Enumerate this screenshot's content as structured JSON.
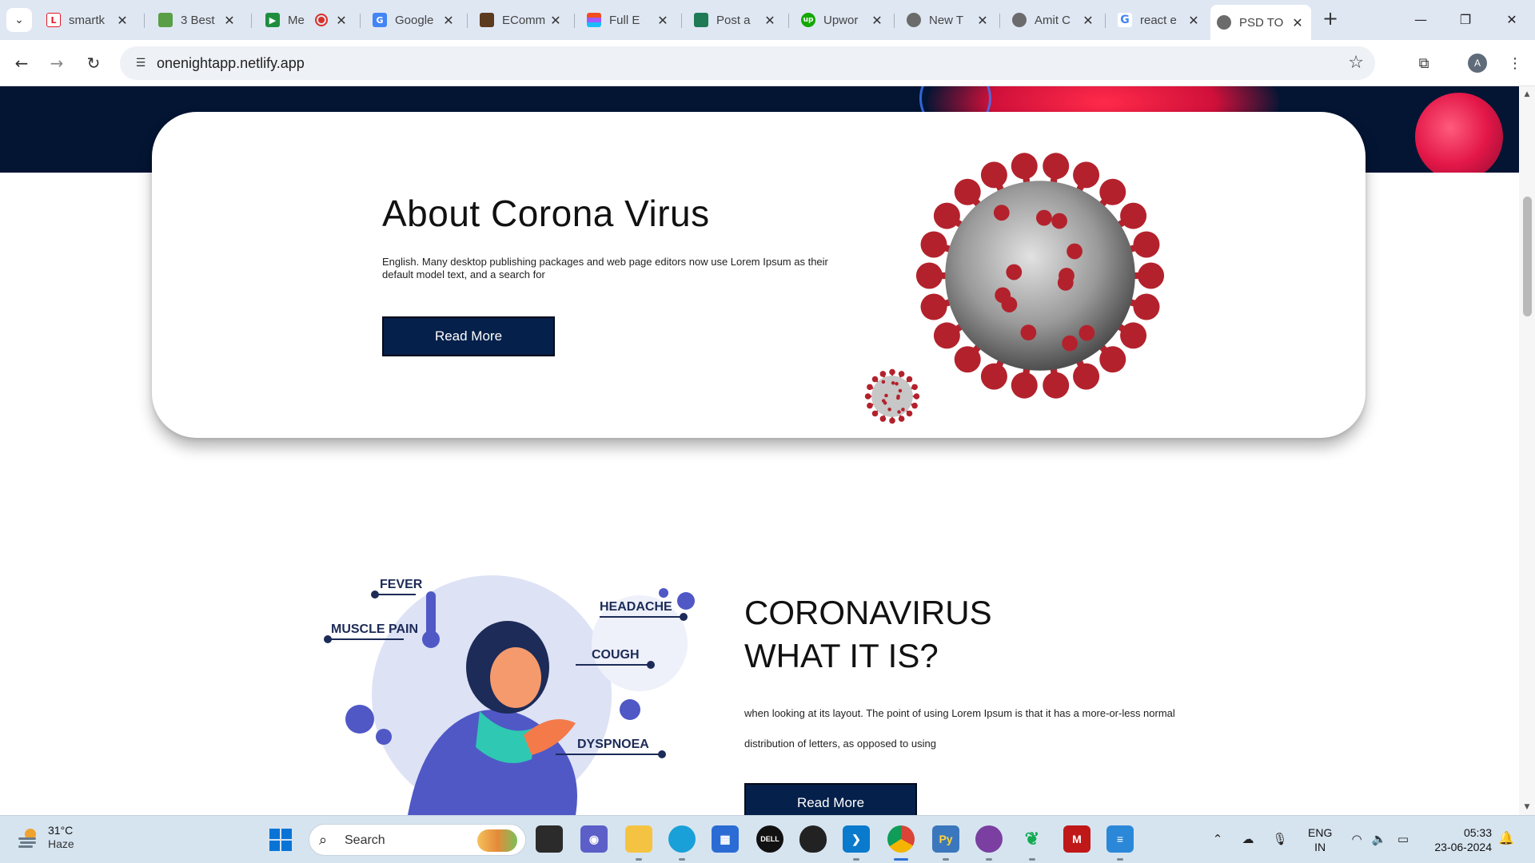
{
  "browser": {
    "tabs": [
      {
        "label": "smartk",
        "icon": "lendingkart-icon",
        "color": "#e31b23"
      },
      {
        "label": "3 Best",
        "icon": "bookmark-icon",
        "color": "#5a9f45"
      },
      {
        "label": "Me",
        "icon": "google-meet-icon",
        "color": "#1e8e3e"
      },
      {
        "label": "Google",
        "icon": "google-translate-icon",
        "color": "#4285f4"
      },
      {
        "label": "EComm",
        "icon": "book-cover-icon",
        "color": "#5b3a1e"
      },
      {
        "label": "Full E",
        "icon": "figma-icon",
        "color": "#f24e1e"
      },
      {
        "label": "Post a",
        "icon": "slideshow-icon",
        "color": "#1f7a55"
      },
      {
        "label": "Upwor",
        "icon": "upwork-icon",
        "color": "#14a800"
      },
      {
        "label": "New T",
        "icon": "chrome-icon",
        "color": "#666666"
      },
      {
        "label": "Amit C",
        "icon": "globe-icon",
        "color": "#666666"
      },
      {
        "label": "react e",
        "icon": "google-icon",
        "color": "#4285f4"
      },
      {
        "label": "PSD TO",
        "icon": "globe-icon",
        "color": "#666666",
        "active": true
      }
    ],
    "url": "onenightapp.netlify.app",
    "profile_initial": "A"
  },
  "page": {
    "about": {
      "title": "About Corona Virus",
      "text": "English. Many desktop publishing packages and web page editors now use Lorem Ipsum as their default model text, and a search for",
      "button": "Read More"
    },
    "what": {
      "title_line1": "CORONAVIRUS",
      "title_line2": "WHAT IT IS?",
      "text": "when looking at its layout. The point of using Lorem Ipsum is that it has a more-or-less normal distribution of letters, as opposed to using",
      "button": "Read More",
      "symptoms": [
        "FEVER",
        "HEADACHE",
        "MUSCLE PAIN",
        "COUGH",
        "DYSPNOEA"
      ]
    }
  },
  "taskbar": {
    "weather_temp": "31°C",
    "weather_desc": "Haze",
    "search_label": "Search",
    "lang_line1": "ENG",
    "lang_line2": "IN",
    "time": "05:33",
    "date": "23-06-2024"
  },
  "colors": {
    "hero_navy": "#031533",
    "button_navy": "#05204a",
    "virus_red": "#b3222c"
  }
}
